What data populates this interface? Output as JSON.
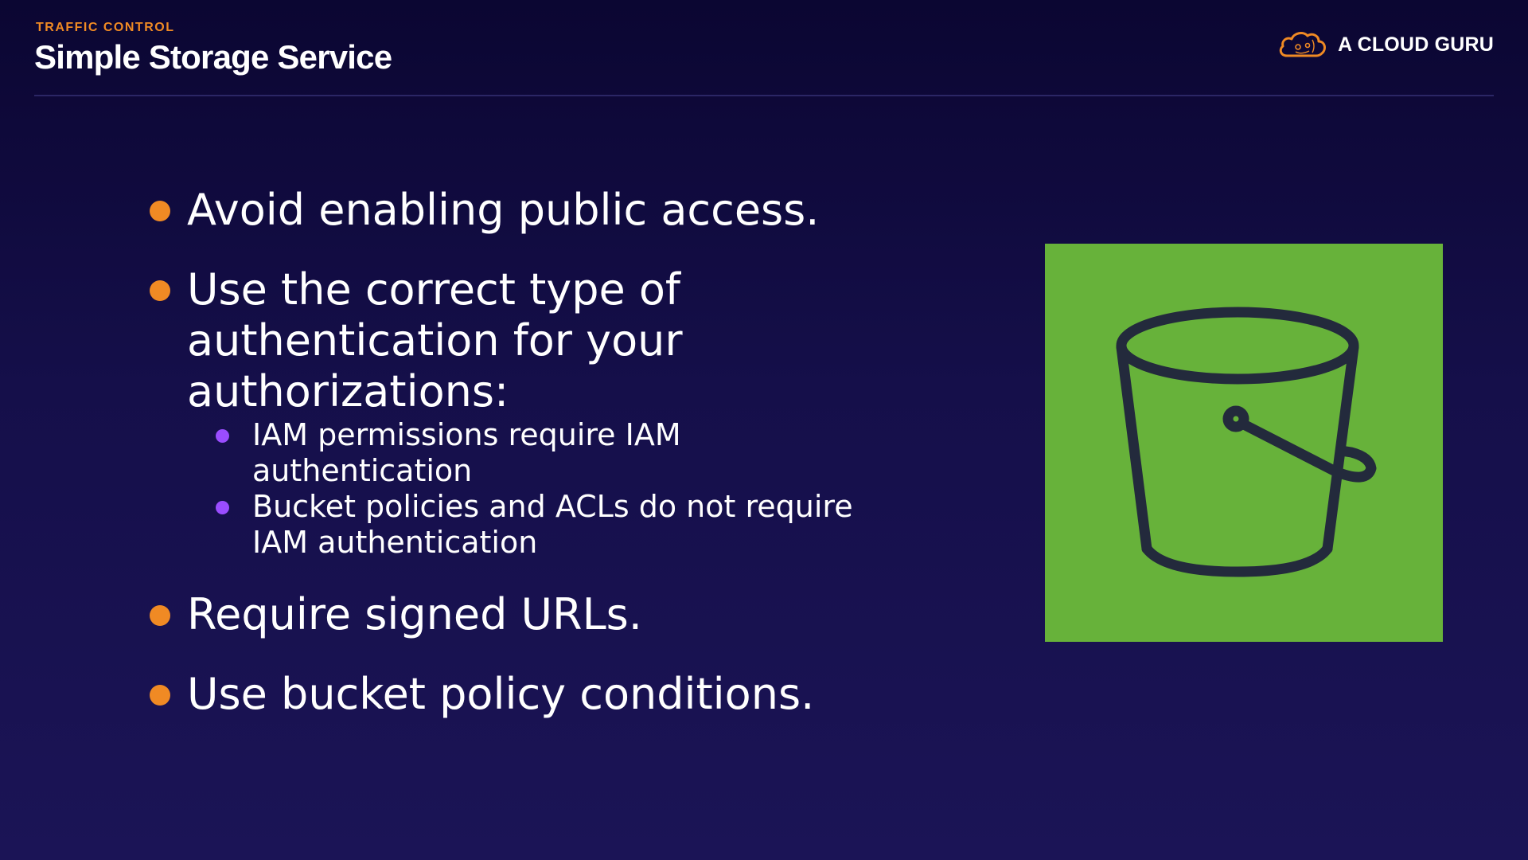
{
  "header": {
    "kicker": "TRAFFIC CONTROL",
    "title": "Simple Storage Service"
  },
  "brand": {
    "name": "A CLOUD GURU",
    "logo_icon": "cloud-logo-icon",
    "logo_color": "#f08a24"
  },
  "bullets": [
    {
      "text": "Avoid enabling public access."
    },
    {
      "text": "Use the correct type of authentication for your authorizations:",
      "sub_items": [
        "IAM permissions require IAM authentication",
        "Bucket policies and ACLs do not require IAM authentication"
      ]
    },
    {
      "text": "Require signed URLs."
    },
    {
      "text": "Use bucket policy conditions."
    }
  ],
  "illustration": {
    "icon": "s3-bucket-icon",
    "background_color": "#67b23a",
    "stroke_color": "#232a3c"
  },
  "colors": {
    "accent_orange": "#f08a24",
    "accent_purple": "#9a4dff",
    "background": "#150f4a"
  }
}
